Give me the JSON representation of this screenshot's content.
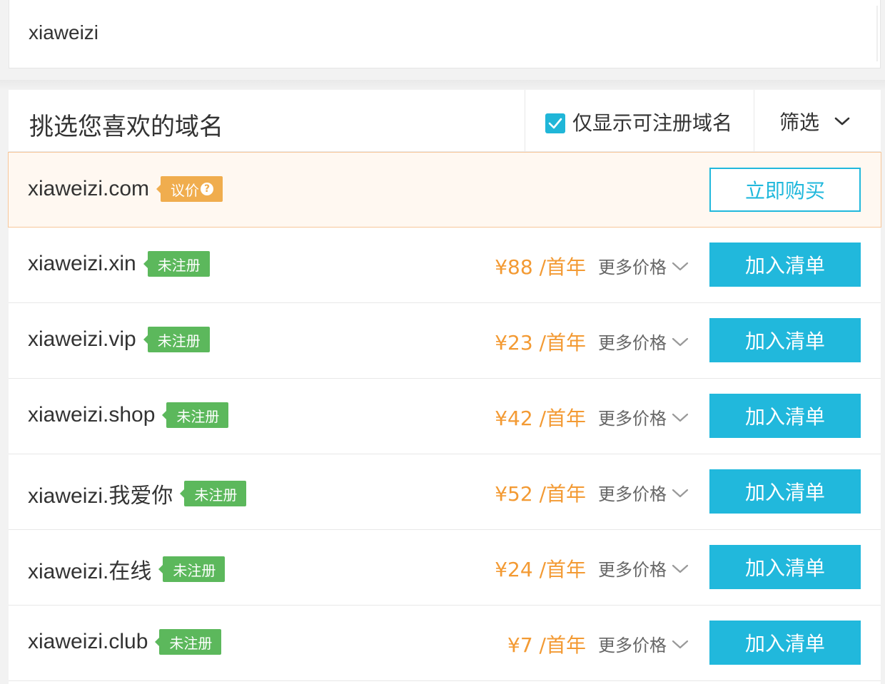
{
  "search": {
    "value": "xiaweizi"
  },
  "header": {
    "title": "挑选您喜欢的域名",
    "checkbox_label": "仅显示可注册域名",
    "checkbox_checked": true,
    "filter_label": "筛选"
  },
  "featured": {
    "domain": "xiaweizi.com",
    "tag": "议价",
    "button": "立即购买"
  },
  "rows": [
    {
      "domain": "xiaweizi.xin",
      "tag": "未注册",
      "price": "¥88 /首年",
      "more": "更多价格",
      "button": "加入清单"
    },
    {
      "domain": "xiaweizi.vip",
      "tag": "未注册",
      "price": "¥23 /首年",
      "more": "更多价格",
      "button": "加入清单"
    },
    {
      "domain": "xiaweizi.shop",
      "tag": "未注册",
      "price": "¥42 /首年",
      "more": "更多价格",
      "button": "加入清单"
    },
    {
      "domain": "xiaweizi.我爱你",
      "tag": "未注册",
      "price": "¥52 /首年",
      "more": "更多价格",
      "button": "加入清单"
    },
    {
      "domain": "xiaweizi.在线",
      "tag": "未注册",
      "price": "¥24 /首年",
      "more": "更多价格",
      "button": "加入清单"
    },
    {
      "domain": "xiaweizi.club",
      "tag": "未注册",
      "price": "¥7 /首年",
      "more": "更多价格",
      "button": "加入清单"
    }
  ],
  "colors": {
    "accent": "#21b8dc",
    "price": "#f39a33",
    "tag_unregistered": "#5cb85c",
    "tag_negotiable": "#f0ad4e",
    "featured_bg": "#fff8f1"
  },
  "icons": {
    "check": "check-icon",
    "chevron": "chevron-down-icon",
    "help": "question-circle-icon"
  }
}
